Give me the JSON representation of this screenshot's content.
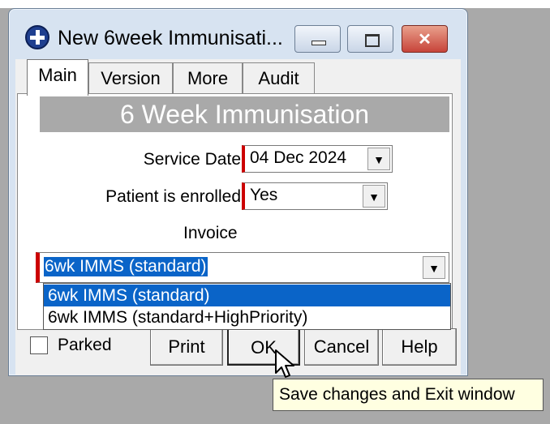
{
  "window": {
    "title": "New 6week Immunisati...",
    "buttons": {
      "minimize": "minimize",
      "maximize": "maximize",
      "close": "close"
    }
  },
  "tabs": [
    {
      "label": "Main",
      "selected": true
    },
    {
      "label": "Version",
      "selected": false
    },
    {
      "label": "More",
      "selected": false
    },
    {
      "label": "Audit",
      "selected": false
    }
  ],
  "banner": "6 Week Immunisation",
  "form": {
    "service_date_label": "Service Date",
    "service_date_value": "04 Dec 2024",
    "enrolled_label": "Patient is enrolled",
    "enrolled_value": "Yes",
    "invoice_label": "Invoice",
    "invoice_value": "6wk IMMS (standard)",
    "invoice_options": [
      "6wk IMMS (standard)",
      "6wk IMMS (standard+HighPriority)"
    ]
  },
  "footer": {
    "parked_label": "Parked",
    "parked_checked": false,
    "print_label": "Print",
    "ok_label": "OK",
    "cancel_label": "Cancel",
    "help_label": "Help"
  },
  "tooltip": "Save changes and Exit window",
  "icons": {
    "app": "health-plus-icon",
    "dropdown": "dropdown-arrow-icon",
    "cursor": "mouse-pointer-icon"
  },
  "colors": {
    "required_marker": "#cc0000",
    "selection": "#0a64c8",
    "tooltip_bg": "#ffffe1",
    "banner_bg": "#a9a9a9"
  }
}
